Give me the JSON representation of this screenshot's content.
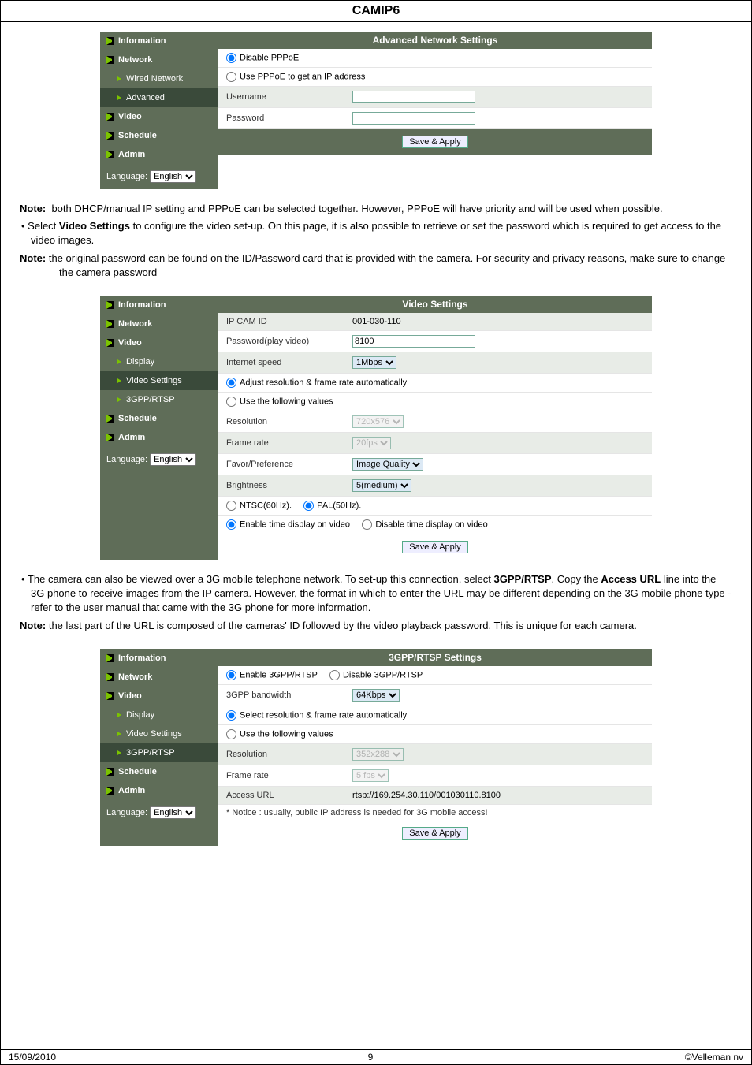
{
  "doc_title": "CAMIP6",
  "sidebar_common": {
    "information": "Information",
    "network": "Network",
    "wired_network": "Wired Network",
    "advanced": "Advanced",
    "video": "Video",
    "display": "Display",
    "video_settings": "Video Settings",
    "gpp_rtsp": "3GPP/RTSP",
    "schedule": "Schedule",
    "admin": "Admin",
    "language_label": "Language:",
    "language_value": "English"
  },
  "shot1": {
    "header": "Advanced Network Settings",
    "disable_pppoe": "Disable PPPoE",
    "use_pppoe": "Use PPPoE to get an IP address",
    "username": "Username",
    "password": "Password",
    "save_apply": "Save & Apply"
  },
  "para1_note_label": "Note:",
  "para1_note": "both DHCP/manual IP setting and PPPoE can be selected together. However, PPPoE will have priority and will be used when possible.",
  "para1_bullet": "Select Video Settings to configure the video set-up. On this page, it is also possible to retrieve or set the password which is required to get access to the video images.",
  "para1_bold": "Video Settings",
  "para2_note_label": "Note:",
  "para2_note": "the original password can be found on the ID/Password card that is provided with the camera. For security and privacy reasons, make sure to change the camera password",
  "shot2": {
    "header": "Video Settings",
    "ip_cam_id": "IP CAM ID",
    "ip_cam_id_val": "001-030-110",
    "password_label": "Password(play video)",
    "password_val": "8100",
    "internet_speed": "Internet speed",
    "internet_speed_val": "1Mbps",
    "auto_adjust": "Adjust resolution & frame rate automatically",
    "use_following": "Use the following values",
    "resolution": "Resolution",
    "resolution_val": "720x576",
    "frame_rate": "Frame rate",
    "frame_rate_val": "20fps",
    "favor": "Favor/Preference",
    "favor_val": "Image Quality",
    "brightness": "Brightness",
    "brightness_val": "5(medium)",
    "ntsc": "NTSC(60Hz).",
    "pal": "PAL(50Hz).",
    "enable_time": "Enable time display on video",
    "disable_time": "Disable time display on video",
    "save_apply": "Save & Apply"
  },
  "para3_bullet": "The camera can also be viewed over a 3G mobile telephone network. To set-up this connection, select 3GPP/RTSP. Copy the Access URL line into the 3G phone to receive images from the IP camera. However, the format in which to enter the URL may be different depending on the 3G mobile phone type - refer to the user manual that came with the 3G phone for more information.",
  "para3_bold1": "3GPP/RTSP",
  "para3_bold2": "Access URL",
  "para4_note_label": "Note:",
  "para4_note": "the last part of the URL is composed of the cameras' ID followed by the video playback password. This is unique for each camera.",
  "shot3": {
    "header": "3GPP/RTSP Settings",
    "enable": "Enable 3GPP/RTSP",
    "disable": "Disable 3GPP/RTSP",
    "bandwidth": "3GPP bandwidth",
    "bandwidth_val": "64Kbps",
    "auto_adjust": "Select resolution & frame rate automatically",
    "use_following": "Use the following values",
    "resolution": "Resolution",
    "resolution_val": "352x288",
    "frame_rate": "Frame rate",
    "frame_rate_val": "5 fps",
    "access_url": "Access URL",
    "access_url_val": "rtsp://169.254.30.110/001030110.8100",
    "notice": "* Notice : usually, public IP address is needed for 3G mobile access!",
    "save_apply": "Save & Apply"
  },
  "footer": {
    "date": "15/09/2010",
    "page": "9",
    "copyright": "©Velleman nv"
  }
}
